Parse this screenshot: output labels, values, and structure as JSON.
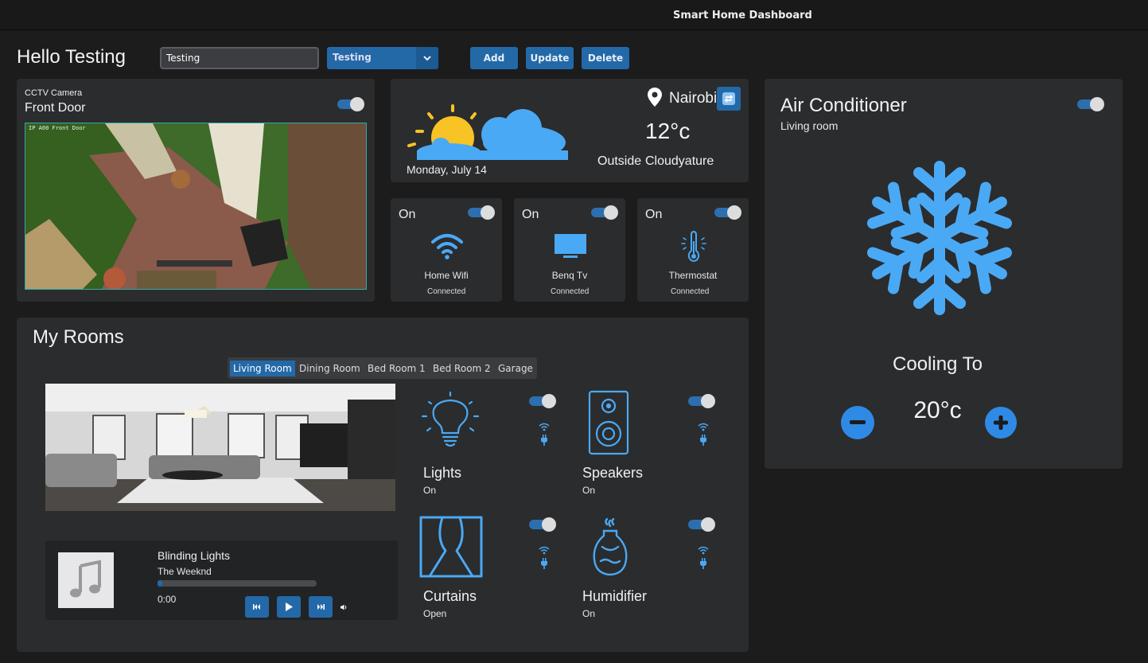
{
  "app": {
    "title": "Smart Home Dashboard"
  },
  "header": {
    "greeting": "Hello Testing",
    "name_input_value": "Testing",
    "select_value": "Testing",
    "add_label": "Add",
    "update_label": "Update",
    "delete_label": "Delete"
  },
  "cctv": {
    "label": "CCTV Camera",
    "location": "Front Door",
    "enabled": true,
    "overlay_text": "IP A00 Front Door"
  },
  "weather": {
    "city": "Nairobi",
    "temperature": "12°c",
    "date": "Monday, July 14",
    "outside_label": "Outside",
    "condition": "Cloudyature"
  },
  "devices": [
    {
      "state": "On",
      "name": "Home Wifi",
      "status": "Connected",
      "icon": "wifi-icon"
    },
    {
      "state": "On",
      "name": "Benq Tv",
      "status": "Connected",
      "icon": "tv-icon"
    },
    {
      "state": "On",
      "name": "Thermostat",
      "status": "Connected",
      "icon": "thermometer-icon"
    }
  ],
  "ac": {
    "title": "Air Conditioner",
    "room": "Living room",
    "cooling_label": "Cooling To",
    "target_temp": "20°c",
    "enabled": true
  },
  "rooms": {
    "title": "My Rooms",
    "tabs": [
      "Living Room",
      "Dining Room",
      "Bed Room 1",
      "Bed Room 2",
      "Garage"
    ],
    "active_tab": "Living Room",
    "cards": [
      {
        "name": "Lights",
        "status": "On",
        "icon": "lightbulb-icon"
      },
      {
        "name": "Speakers",
        "status": "On",
        "icon": "speaker-icon"
      },
      {
        "name": "Curtains",
        "status": "Open",
        "icon": "curtains-icon"
      },
      {
        "name": "Humidifier",
        "status": "On",
        "icon": "humidifier-icon"
      }
    ]
  },
  "player": {
    "song": "Blinding Lights",
    "artist": "The Weeknd",
    "time": "0:00",
    "progress": 0.03
  },
  "colors": {
    "accent": "#2369a8",
    "icon_blue": "#4aa9f5",
    "panel": "#2b2c2e",
    "background": "#1c1c1d"
  }
}
